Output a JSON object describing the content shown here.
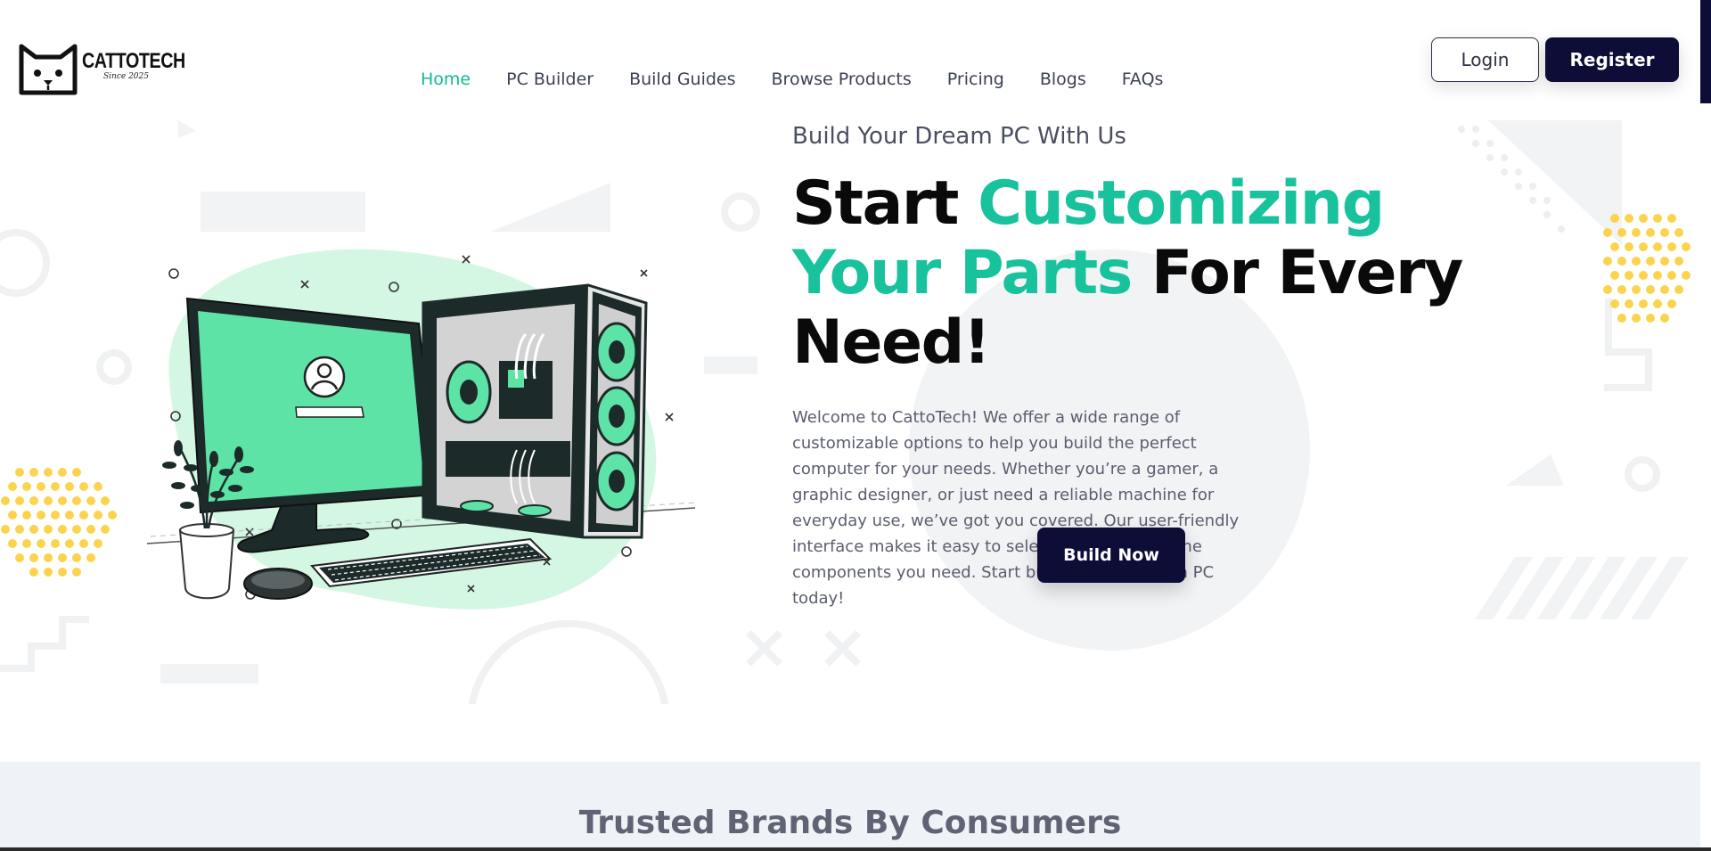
{
  "brand": {
    "name": "CATTOTECH",
    "since": "Since 2025"
  },
  "nav": {
    "items": [
      {
        "label": "Home",
        "active": true
      },
      {
        "label": "PC Builder",
        "active": false
      },
      {
        "label": "Build Guides",
        "active": false
      },
      {
        "label": "Browse Products",
        "active": false
      },
      {
        "label": "Pricing",
        "active": false
      },
      {
        "label": "Blogs",
        "active": false
      },
      {
        "label": "FAQs",
        "active": false
      }
    ]
  },
  "auth": {
    "login_label": "Login",
    "register_label": "Register"
  },
  "hero": {
    "tagline": "Build Your Dream PC With Us",
    "headline_part1": "Start ",
    "headline_accent1": "Customizing",
    "headline_accent2": "Your Parts",
    "headline_part2": " For Every Need!",
    "description": "Welcome to CattoTech! We offer a wide range of customizable options to help you build the perfect computer for your needs. Whether you’re a gamer, a graphic designer, or just need a reliable machine for everyday use, we’ve got you covered. Our user-friendly interface makes it easy to select and assemble the components you need. Start building your dream PC today!",
    "cta_label": "Build Now"
  },
  "brands": {
    "title": "Trusted Brands By Consumers"
  },
  "colors": {
    "accent": "#18c29c",
    "nav_active": "#13b997",
    "primary_dark": "#0d0d38",
    "text_muted": "#5a5e6e",
    "band_bg": "#eff3f7",
    "dots_yellow": "#fcd34d",
    "monitor_green": "#5ee3a6",
    "blob_green": "#d4f7e4"
  },
  "icons": {
    "logo": "cat-face-icon",
    "illustration": "pc-setup-illustration"
  }
}
